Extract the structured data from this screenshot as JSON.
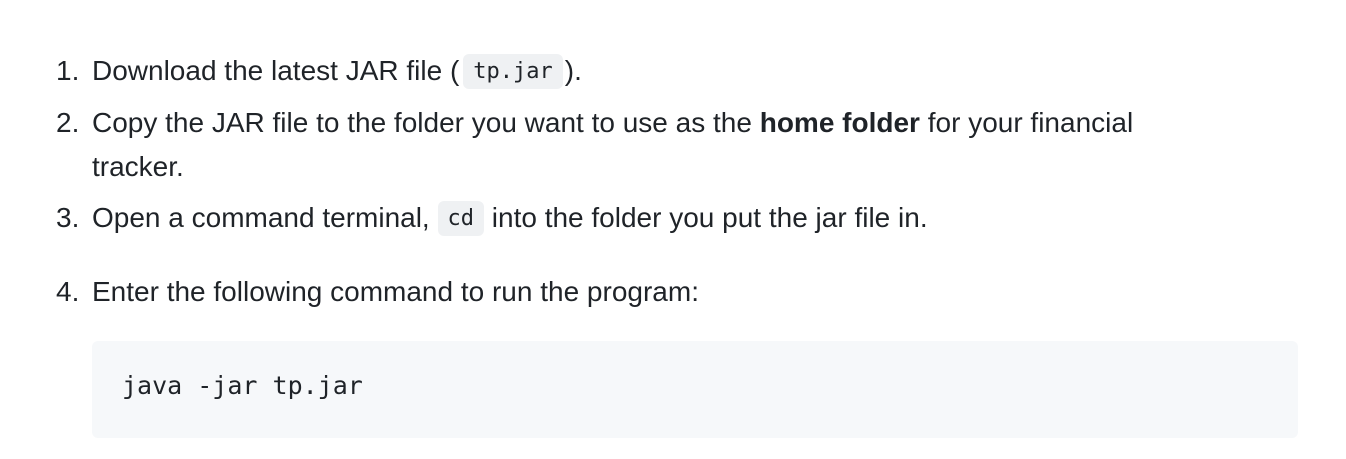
{
  "steps": [
    {
      "number": "1.",
      "before": "Download the latest JAR file (",
      "code": "tp.jar",
      "after": ")."
    },
    {
      "number": "2.",
      "before": "Copy the JAR file to the folder you want to use as the ",
      "bold": "home folder",
      "after": " for your financial",
      "continuation": "tracker."
    },
    {
      "number": "3.",
      "before": "Open a command terminal, ",
      "code": "cd",
      "after": " into the folder you put the jar file in."
    },
    {
      "number": "4.",
      "text": "Enter the following command to run the program:"
    }
  ],
  "command": "java -jar tp.jar"
}
